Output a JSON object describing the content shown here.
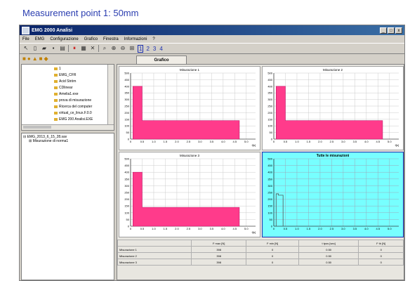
{
  "caption": "Measurement point 1: 50mm",
  "window": {
    "title": "EMG 2000 Analisi",
    "buttons": [
      "_",
      "□",
      "x"
    ]
  },
  "menu": [
    "File",
    "EMG",
    "Configurazione",
    "Grafico",
    "Finestra",
    "Informazioni",
    "?"
  ],
  "toolbar": {
    "numbers": [
      "1",
      "2",
      "3",
      "4"
    ]
  },
  "filetree": {
    "items": [
      "1",
      "EMG_CFR",
      "Acid Ström",
      "CDlinear",
      "Amelia1.exe",
      "prova di misurazione",
      "Ricerca del computer",
      "virtual_ce_linux.F.0.0",
      "EMG 200 Analisi.EXE"
    ]
  },
  "meastree": {
    "root": "EMG_2013_6_15_28.sav",
    "child": "Misurazione di norma1"
  },
  "tab": {
    "label": "Grafico"
  },
  "colors": {
    "bar": "#ff3b8b",
    "bar_edge": "#c0186a",
    "cyan": "#7ffeff",
    "title_blue": "#2a3db0"
  },
  "chart_data": [
    {
      "type": "area",
      "title": "Misurazione 1",
      "xlabel": "t[s]",
      "x_ticks": [
        "0",
        "0.5",
        "1.0",
        "1.5",
        "2.0",
        "2.5",
        "3.0",
        "3.5",
        "4.0",
        "4.5",
        "5.0"
      ],
      "y_ticks": [
        "0",
        "50",
        "100",
        "150",
        "200",
        "250",
        "300",
        "350",
        "400",
        "450",
        "500"
      ],
      "xlim": [
        0,
        5.4
      ],
      "ylim": [
        0,
        500
      ],
      "points": [
        [
          0.1,
          400
        ],
        [
          0.5,
          400
        ],
        [
          0.5,
          140
        ],
        [
          4.7,
          140
        ],
        [
          4.7,
          0
        ]
      ]
    },
    {
      "type": "area",
      "title": "Misurazione 2",
      "xlabel": "t[s]",
      "x_ticks": [
        "0",
        "0.5",
        "1.0",
        "1.5",
        "2.0",
        "2.5",
        "3.0",
        "3.5",
        "4.0",
        "4.5",
        "5.0"
      ],
      "y_ticks": [
        "0",
        "50",
        "100",
        "150",
        "200",
        "250",
        "300",
        "350",
        "400",
        "450",
        "500"
      ],
      "xlim": [
        0,
        5.4
      ],
      "ylim": [
        0,
        500
      ],
      "points": [
        [
          0.1,
          400
        ],
        [
          0.5,
          400
        ],
        [
          0.5,
          140
        ],
        [
          4.7,
          140
        ],
        [
          4.7,
          0
        ]
      ]
    },
    {
      "type": "area",
      "title": "Misurazione 3",
      "xlabel": "t[s]",
      "x_ticks": [
        "0",
        "0.5",
        "1.0",
        "1.5",
        "2.0",
        "2.5",
        "3.0",
        "3.5",
        "4.0",
        "4.5",
        "5.0"
      ],
      "y_ticks": [
        "0",
        "50",
        "100",
        "150",
        "200",
        "250",
        "300",
        "350",
        "400",
        "450",
        "500"
      ],
      "xlim": [
        0,
        5.4
      ],
      "ylim": [
        0,
        500
      ],
      "points": [
        [
          0.1,
          400
        ],
        [
          0.5,
          400
        ],
        [
          0.5,
          140
        ],
        [
          4.7,
          140
        ],
        [
          4.7,
          0
        ]
      ]
    },
    {
      "type": "line",
      "title": "Tutte le misurazioni",
      "xlabel": "",
      "x_ticks": [
        "0",
        "0.5",
        "1.0",
        "1.5",
        "2.0",
        "2.5",
        "3.0",
        "3.5",
        "4.0",
        "4.5",
        "5.0"
      ],
      "y_ticks": [
        "0",
        "50",
        "100",
        "150",
        "200",
        "250",
        "300",
        "350",
        "400",
        "450",
        "500"
      ],
      "xlim": [
        0,
        5.4
      ],
      "ylim": [
        0,
        500
      ],
      "points": [
        [
          0.1,
          0
        ],
        [
          0.1,
          240
        ],
        [
          0.2,
          240
        ],
        [
          0.2,
          230
        ],
        [
          0.4,
          230
        ],
        [
          0.4,
          0
        ]
      ]
    }
  ],
  "table": {
    "headers": [
      "",
      "F max [N]",
      "F min [N]",
      "t tpos [sec]",
      "F th [N]"
    ],
    "rows": [
      [
        "Misurazione 1",
        "398",
        "0",
        "0.50",
        "0"
      ],
      [
        "Misurazione 2",
        "398",
        "0",
        "0.50",
        "0"
      ],
      [
        "Misurazione 3",
        "398",
        "0",
        "0.50",
        "0"
      ]
    ]
  }
}
